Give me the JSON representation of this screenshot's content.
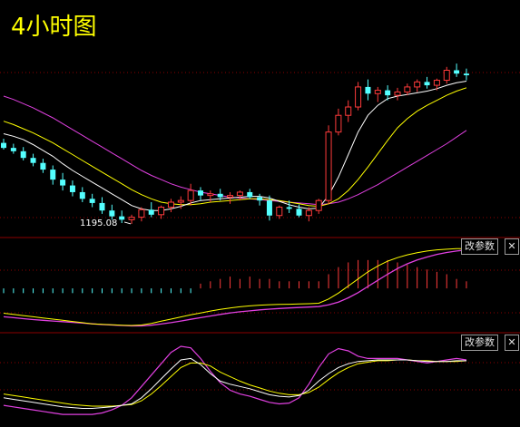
{
  "title": "4小时图",
  "colors": {
    "background": "#000000",
    "up": "#ff3b3b",
    "down": "#54ffff",
    "ma_white": "#ffffff",
    "ma_yellow": "#ffff00",
    "ma_magenta": "#e040e0",
    "grid": "#8b0000",
    "title": "#ffff00"
  },
  "panels": [
    {
      "id": "macd",
      "param_button": "改参数",
      "close_icon": "x-icon"
    },
    {
      "id": "kdj",
      "param_button": "改参数",
      "close_icon": "x-icon"
    }
  ],
  "chart_data": [
    {
      "type": "candlestick",
      "title": "4小时图",
      "annotation": "1195.08",
      "ylim": [
        1180,
        1395
      ],
      "ohlc": [
        [
          1289,
          1294,
          1281,
          1283
        ],
        [
          1283,
          1288,
          1276,
          1279
        ],
        [
          1279,
          1284,
          1268,
          1271
        ],
        [
          1271,
          1276,
          1261,
          1265
        ],
        [
          1265,
          1270,
          1253,
          1257
        ],
        [
          1257,
          1262,
          1239,
          1245
        ],
        [
          1245,
          1253,
          1232,
          1238
        ],
        [
          1238,
          1244,
          1225,
          1230
        ],
        [
          1230,
          1236,
          1218,
          1222
        ],
        [
          1222,
          1228,
          1212,
          1217
        ],
        [
          1217,
          1224,
          1204,
          1208
        ],
        [
          1208,
          1215,
          1197,
          1201
        ],
        [
          1201,
          1208,
          1193,
          1197
        ],
        [
          1197,
          1203,
          1192,
          1200
        ],
        [
          1200,
          1212,
          1195,
          1209
        ],
        [
          1209,
          1218,
          1200,
          1203
        ],
        [
          1203,
          1214,
          1198,
          1212
        ],
        [
          1212,
          1222,
          1206,
          1218
        ],
        [
          1218,
          1225,
          1210,
          1220
        ],
        [
          1220,
          1240,
          1214,
          1232
        ],
        [
          1232,
          1236,
          1220,
          1226
        ],
        [
          1226,
          1232,
          1218,
          1228
        ],
        [
          1228,
          1234,
          1220,
          1224
        ],
        [
          1224,
          1230,
          1216,
          1226
        ],
        [
          1226,
          1232,
          1220,
          1230
        ],
        [
          1230,
          1234,
          1222,
          1224
        ],
        [
          1224,
          1228,
          1214,
          1220
        ],
        [
          1220,
          1226,
          1196,
          1202
        ],
        [
          1202,
          1214,
          1198,
          1212
        ],
        [
          1212,
          1220,
          1205,
          1210
        ],
        [
          1210,
          1215,
          1200,
          1202
        ],
        [
          1202,
          1212,
          1195,
          1208
        ],
        [
          1208,
          1222,
          1204,
          1220
        ],
        [
          1220,
          1310,
          1216,
          1302
        ],
        [
          1302,
          1330,
          1298,
          1322
        ],
        [
          1322,
          1340,
          1314,
          1332
        ],
        [
          1332,
          1362,
          1328,
          1356
        ],
        [
          1356,
          1365,
          1340,
          1348
        ],
        [
          1348,
          1356,
          1338,
          1352
        ],
        [
          1352,
          1358,
          1340,
          1346
        ],
        [
          1346,
          1355,
          1340,
          1350
        ],
        [
          1350,
          1360,
          1346,
          1356
        ],
        [
          1356,
          1365,
          1350,
          1362
        ],
        [
          1362,
          1368,
          1354,
          1358
        ],
        [
          1358,
          1366,
          1352,
          1364
        ],
        [
          1364,
          1380,
          1360,
          1376
        ],
        [
          1376,
          1384,
          1368,
          1372
        ],
        [
          1372,
          1378,
          1364,
          1370
        ]
      ],
      "ma_white": [
        1300,
        1297,
        1293,
        1287,
        1280,
        1273,
        1264,
        1256,
        1249,
        1242,
        1235,
        1228,
        1221,
        1214,
        1210,
        1208,
        1208,
        1210,
        1213,
        1217,
        1220,
        1221,
        1222,
        1223,
        1224,
        1225,
        1225,
        1223,
        1219,
        1215,
        1212,
        1210,
        1211,
        1226,
        1248,
        1275,
        1302,
        1322,
        1334,
        1342,
        1345,
        1347,
        1349,
        1351,
        1354,
        1358,
        1361,
        1363
      ],
      "ma_yellow": [
        1315,
        1311,
        1306,
        1301,
        1295,
        1289,
        1282,
        1275,
        1268,
        1261,
        1254,
        1247,
        1240,
        1233,
        1227,
        1222,
        1218,
        1216,
        1215,
        1215,
        1216,
        1218,
        1219,
        1220,
        1221,
        1222,
        1222,
        1221,
        1220,
        1218,
        1216,
        1214,
        1213,
        1216,
        1222,
        1232,
        1245,
        1260,
        1276,
        1292,
        1307,
        1318,
        1327,
        1334,
        1340,
        1346,
        1351,
        1355
      ],
      "ma_magenta": [
        1345,
        1341,
        1336,
        1331,
        1325,
        1319,
        1312,
        1305,
        1298,
        1291,
        1284,
        1277,
        1270,
        1263,
        1256,
        1250,
        1245,
        1240,
        1236,
        1233,
        1230,
        1228,
        1226,
        1224,
        1223,
        1222,
        1221,
        1220,
        1219,
        1218,
        1217,
        1216,
        1215,
        1216,
        1218,
        1222,
        1227,
        1233,
        1239,
        1246,
        1253,
        1260,
        1267,
        1274,
        1281,
        1288,
        1296,
        1304
      ]
    },
    {
      "type": "macd",
      "param_label": "改参数",
      "ylim": [
        -18,
        20
      ],
      "hist": [
        -2,
        -2,
        -2,
        -2,
        -2,
        -2,
        -2,
        -2,
        -2,
        -2,
        -2,
        -2,
        -2,
        -2,
        -2,
        -2,
        -2,
        -2,
        -2,
        -2,
        2,
        3,
        4,
        5,
        4,
        5,
        4,
        4,
        3,
        3,
        3,
        3,
        3,
        6,
        9,
        11,
        12,
        12,
        12,
        12,
        11,
        10,
        9,
        8,
        7,
        6,
        4,
        3
      ],
      "dif": [
        -10.5,
        -11,
        -11.5,
        -12,
        -12.5,
        -13,
        -13.5,
        -14,
        -14.5,
        -15,
        -15.2,
        -15.4,
        -15.6,
        -15.7,
        -15.5,
        -14.8,
        -13.9,
        -13,
        -12.1,
        -11.2,
        -10.4,
        -9.6,
        -8.9,
        -8.3,
        -7.8,
        -7.4,
        -7.1,
        -6.9,
        -6.8,
        -6.7,
        -6.6,
        -6.5,
        -6.3,
        -4.5,
        -2,
        1,
        4,
        7,
        9.5,
        11.5,
        13,
        14.2,
        15.1,
        15.8,
        16.3,
        16.6,
        16.8,
        16.9
      ],
      "dea": [
        -12,
        -12.4,
        -12.8,
        -13.2,
        -13.5,
        -13.8,
        -14.1,
        -14.4,
        -14.7,
        -15,
        -15.3,
        -15.5,
        -15.7,
        -15.9,
        -15.9,
        -15.6,
        -15.1,
        -14.5,
        -13.8,
        -13.1,
        -12.4,
        -11.7,
        -11,
        -10.4,
        -9.9,
        -9.5,
        -9.1,
        -8.8,
        -8.5,
        -8.3,
        -8.1,
        -7.9,
        -7.7,
        -7,
        -5.8,
        -4,
        -1.8,
        0.8,
        3.4,
        6,
        8.4,
        10.4,
        12,
        13.3,
        14.4,
        15.2,
        15.8,
        16.3
      ]
    },
    {
      "type": "kdj",
      "param_label": "改参数",
      "ylim": [
        -5,
        110
      ],
      "k": [
        30,
        28,
        26,
        24,
        22,
        20,
        18,
        17,
        16,
        16,
        17,
        18,
        20,
        22,
        30,
        42,
        55,
        68,
        80,
        82,
        74,
        62,
        52,
        48,
        45,
        42,
        38,
        34,
        32,
        31,
        33,
        40,
        52,
        62,
        70,
        75,
        78,
        79,
        80,
        80,
        80,
        80,
        79,
        78,
        78,
        78,
        79,
        79
      ],
      "d": [
        35,
        33,
        31,
        29,
        27,
        25,
        23,
        21,
        20,
        19,
        19,
        19,
        20,
        21,
        26,
        35,
        46,
        58,
        70,
        76,
        76,
        72,
        64,
        58,
        52,
        47,
        43,
        39,
        36,
        34,
        34,
        37,
        44,
        54,
        63,
        70,
        75,
        77,
        79,
        79,
        80,
        80,
        79,
        79,
        78,
        78,
        78,
        79
      ],
      "j": [
        20,
        18,
        16,
        14,
        12,
        10,
        8,
        8,
        8,
        8,
        10,
        14,
        20,
        30,
        45,
        60,
        75,
        90,
        98,
        96,
        82,
        65,
        50,
        40,
        35,
        32,
        28,
        24,
        22,
        23,
        30,
        48,
        70,
        88,
        95,
        92,
        85,
        82,
        82,
        82,
        82,
        80,
        78,
        76,
        78,
        80,
        82,
        80
      ]
    }
  ]
}
